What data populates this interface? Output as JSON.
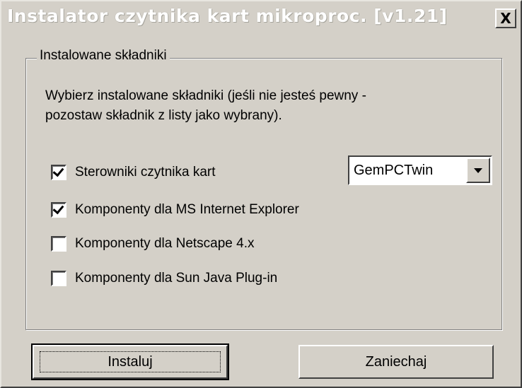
{
  "window": {
    "title": "Instalator czytnika kart mikroproc. [v1.21]",
    "close_label": "X"
  },
  "group": {
    "label": "Instalowane składniki",
    "description_line1": "Wybierz instalowane składniki (jeśli nie jesteś pewny -",
    "description_line2": "pozostaw składnik z listy jako wybrany)."
  },
  "components": [
    {
      "label": "Sterowniki czytnika kart",
      "checked": true
    },
    {
      "label": "Komponenty dla MS Internet Explorer",
      "checked": true
    },
    {
      "label": "Komponenty dla Netscape 4.x",
      "checked": false
    },
    {
      "label": "Komponenty dla Sun Java Plug-in",
      "checked": false
    }
  ],
  "reader_select": {
    "value": "GemPCTwin"
  },
  "buttons": {
    "install": "Instaluj",
    "cancel": "Zaniechaj"
  }
}
